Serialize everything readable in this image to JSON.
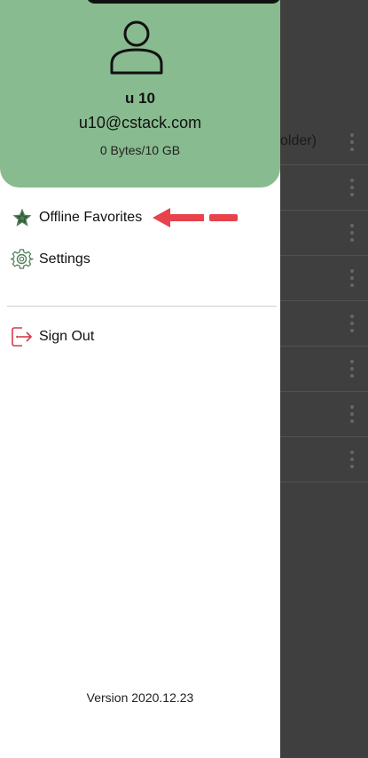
{
  "background": {
    "row_partial_text": "older)",
    "row_count": 8
  },
  "profile": {
    "name": "u 10",
    "email": "u10@cstack.com",
    "storage": "0 Bytes/10 GB"
  },
  "menu": {
    "offline_favorites": "Offline Favorites",
    "settings": "Settings",
    "sign_out": "Sign Out"
  },
  "footer": {
    "version": "Version 2020.12.23"
  },
  "colors": {
    "header_green": "#88bb8f",
    "star_green": "#4f7f58",
    "sign_out_red": "#d33b4a",
    "annotation_arrow": "#e8434d"
  },
  "icons": {
    "avatar": "person-outline-icon",
    "offline_favorites": "star-icon",
    "settings": "gear-icon",
    "sign_out": "sign-out-icon",
    "row_menu": "kebab-menu-icon"
  }
}
